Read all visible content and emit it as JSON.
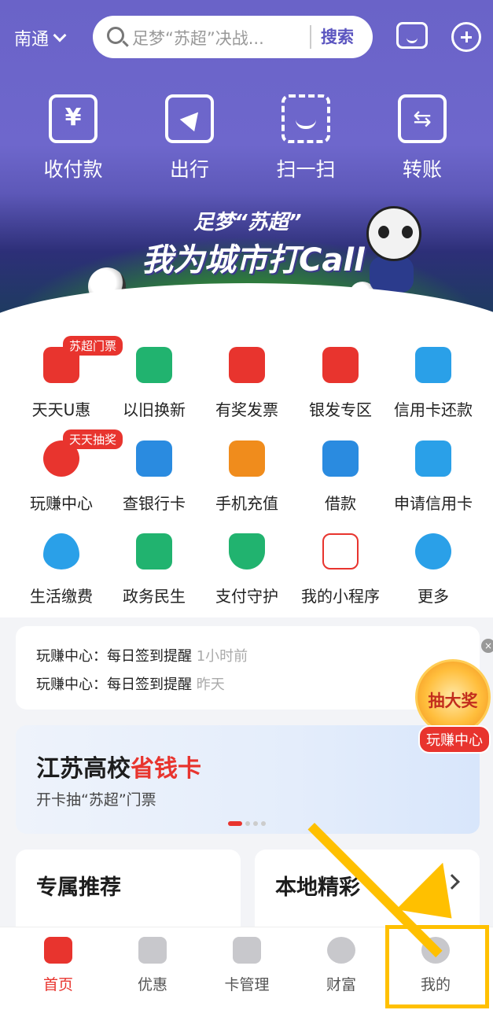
{
  "header": {
    "city": "南通",
    "search_placeholder": "足梦“苏超”决战...",
    "search_button": "搜索",
    "colors": {
      "header_bg": "#6a63c8",
      "accent": "#e8342e"
    }
  },
  "quick_actions": [
    {
      "label": "收付款",
      "icon": "yuan-qr-icon"
    },
    {
      "label": "出行",
      "icon": "navigation-icon"
    },
    {
      "label": "扫一扫",
      "icon": "scan-icon"
    },
    {
      "label": "转账",
      "icon": "transfer-icon"
    }
  ],
  "banner": {
    "line1": "足梦“苏超”",
    "line2": "我为城市打Call"
  },
  "services": [
    {
      "label": "天天U惠",
      "badge": "苏超门票",
      "icon": "u-coupon-icon",
      "color": "#e8342e"
    },
    {
      "label": "以旧换新",
      "badge": "",
      "icon": "trade-in-icon",
      "color": "#21b36f"
    },
    {
      "label": "有奖发票",
      "badge": "",
      "icon": "invoice-draw-icon",
      "color": "#e8342e"
    },
    {
      "label": "银发专区",
      "badge": "",
      "icon": "silver-zone-icon",
      "color": "#e8342e"
    },
    {
      "label": "信用卡还款",
      "badge": "",
      "icon": "credit-repay-icon",
      "color": "#2aa0e8"
    },
    {
      "label": "玩赚中心",
      "badge": "天天抽奖",
      "icon": "earn-center-icon",
      "color": "#e8342e"
    },
    {
      "label": "查银行卡",
      "badge": "",
      "icon": "bank-card-icon",
      "color": "#2a8be0"
    },
    {
      "label": "手机充值",
      "badge": "",
      "icon": "phone-recharge-icon",
      "color": "#f08c1c"
    },
    {
      "label": "借款",
      "badge": "",
      "icon": "loan-icon",
      "color": "#2a8be0"
    },
    {
      "label": "申请信用卡",
      "badge": "",
      "icon": "apply-card-icon",
      "color": "#2aa0e8"
    },
    {
      "label": "生活缴费",
      "badge": "",
      "icon": "water-drop-icon",
      "color": "#2aa0e8"
    },
    {
      "label": "政务民生",
      "badge": "",
      "icon": "home-heart-icon",
      "color": "#21b36f"
    },
    {
      "label": "支付守护",
      "badge": "",
      "icon": "shield-check-icon",
      "color": "#21b36f"
    },
    {
      "label": "我的小程序",
      "badge": "",
      "icon": "mini-program-icon",
      "color": "#e8342e"
    },
    {
      "label": "更多",
      "badge": "",
      "icon": "more-grid-icon",
      "color": "#2aa0e8"
    }
  ],
  "notifications": [
    {
      "label": "玩赚中心：每日签到提醒",
      "time": "1小时前"
    },
    {
      "label": "玩赚中心：每日签到提醒",
      "time": "昨天"
    }
  ],
  "promo": {
    "title_a": "江苏高校",
    "title_b": "省钱卡",
    "subtitle": "开卡抽“苏超”门票"
  },
  "floating": {
    "wheel_text": "抽大奖",
    "tag": "玩赚中心"
  },
  "cards": [
    {
      "title": "专属推荐"
    },
    {
      "title": "本地精彩"
    }
  ],
  "tabs": [
    {
      "label": "首页",
      "icon": "home-icon",
      "active": true
    },
    {
      "label": "优惠",
      "icon": "coupon-icon",
      "active": false
    },
    {
      "label": "卡管理",
      "icon": "card-icon",
      "active": false
    },
    {
      "label": "财富",
      "icon": "wealth-icon",
      "active": false
    },
    {
      "label": "我的",
      "icon": "profile-icon",
      "active": false
    }
  ]
}
